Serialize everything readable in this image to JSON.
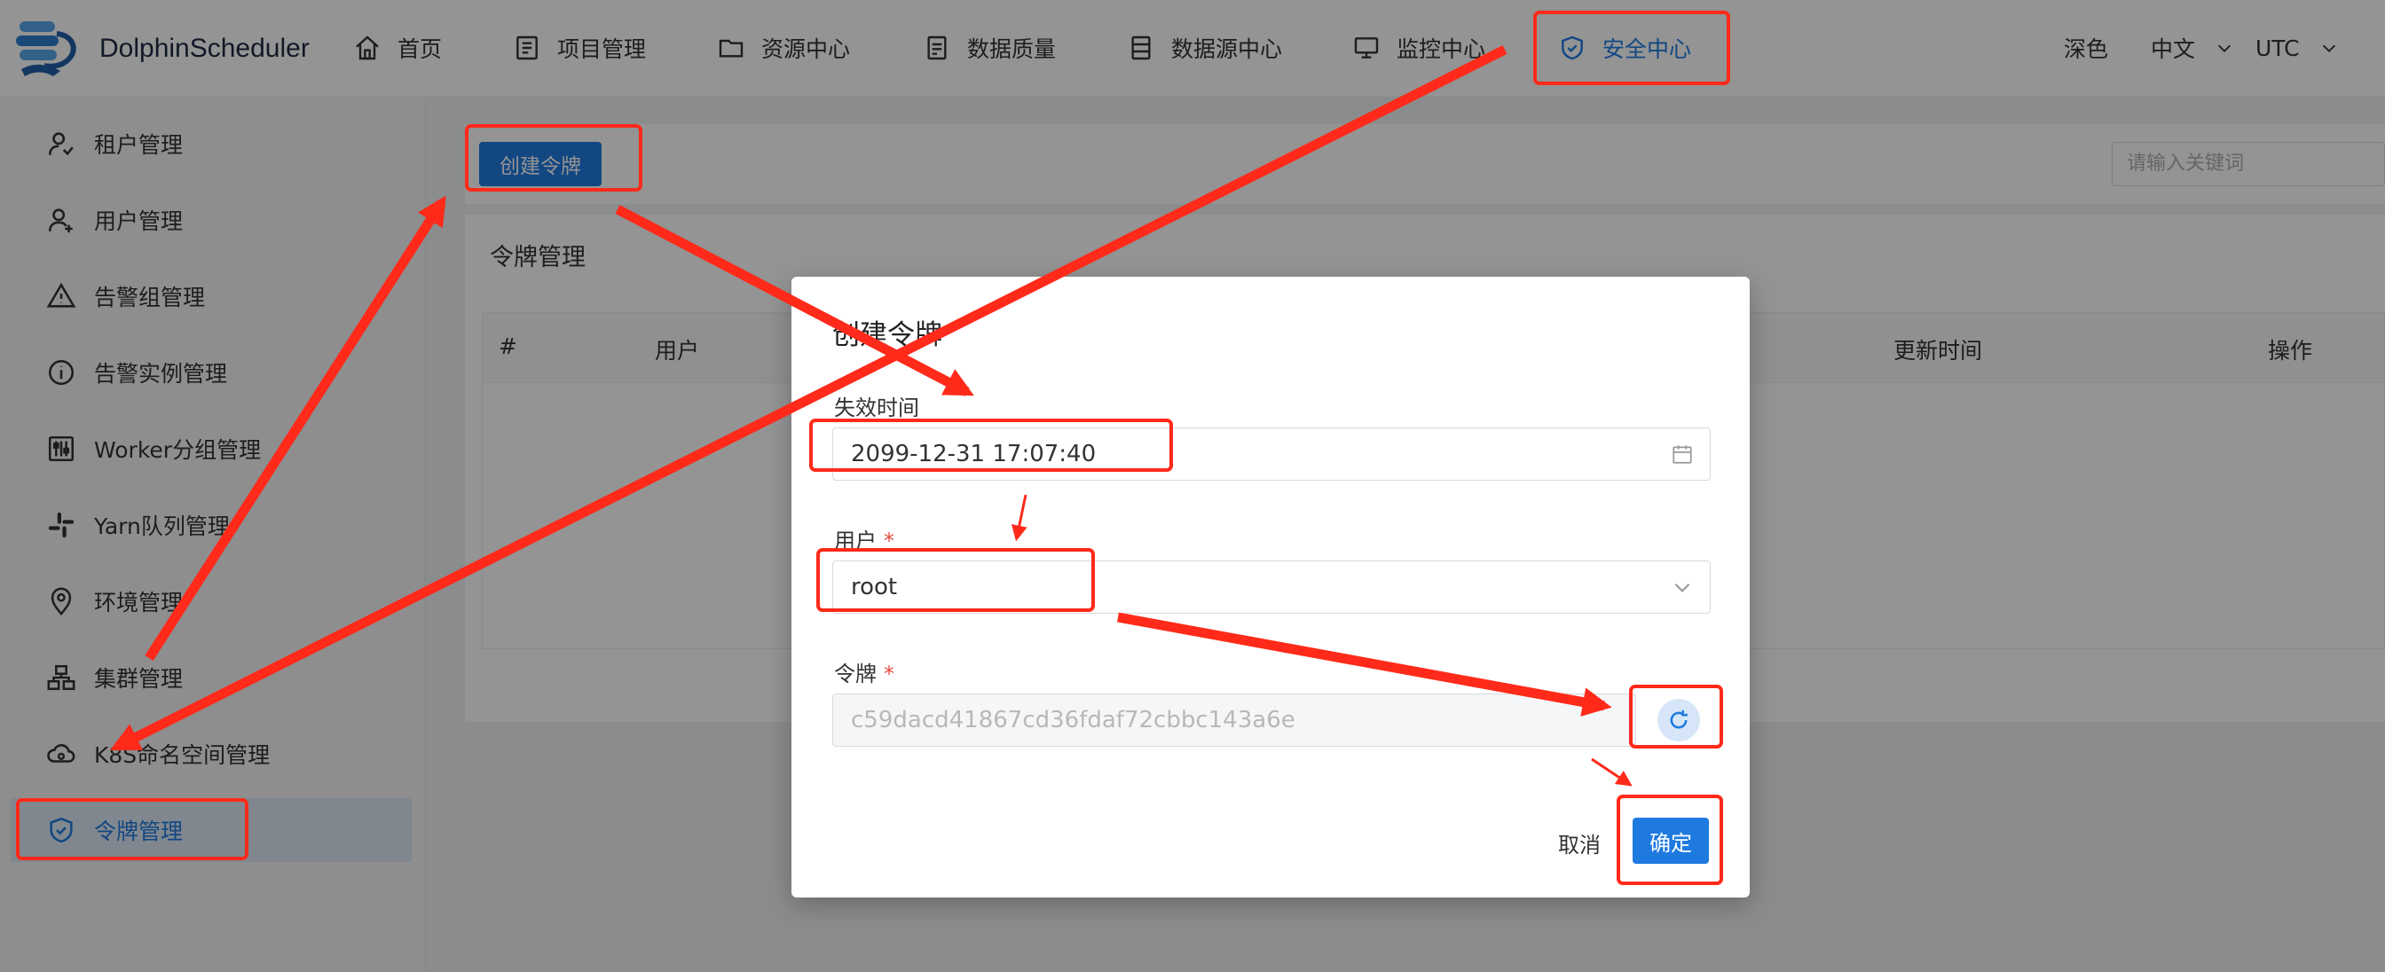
{
  "app": {
    "name": "DolphinScheduler"
  },
  "nav": {
    "items": [
      {
        "label": "首页"
      },
      {
        "label": "项目管理"
      },
      {
        "label": "资源中心"
      },
      {
        "label": "数据质量"
      },
      {
        "label": "数据源中心"
      },
      {
        "label": "监控中心"
      },
      {
        "label": "安全中心"
      }
    ],
    "active_index": 6,
    "theme": "深色",
    "language": "中文",
    "timezone": "UTC"
  },
  "sidebar": {
    "items": [
      {
        "label": "租户管理"
      },
      {
        "label": "用户管理"
      },
      {
        "label": "告警组管理"
      },
      {
        "label": "告警实例管理"
      },
      {
        "label": "Worker分组管理"
      },
      {
        "label": "Yarn队列管理"
      },
      {
        "label": "环境管理"
      },
      {
        "label": "集群管理"
      },
      {
        "label": "K8S命名空间管理"
      },
      {
        "label": "令牌管理"
      }
    ],
    "active_index": 9
  },
  "toolbar": {
    "create_label": "创建令牌",
    "search_placeholder": "请输入关键词"
  },
  "panel": {
    "title": "令牌管理",
    "columns": [
      "#",
      "用户",
      "更新时间",
      "操作"
    ]
  },
  "modal": {
    "title": "创建令牌",
    "expire_label": "失效时间",
    "expire_value": "2099-12-31 17:07:40",
    "user_label": "用户",
    "user_value": "root",
    "token_label": "令牌",
    "token_value": "c59dacd41867cd36fdaf72cbbc143a6e",
    "cancel_label": "取消",
    "confirm_label": "确定"
  },
  "colors": {
    "primary": "#1f7ae0",
    "annotation_red": "#ff2a1a",
    "overlay": "rgba(0,0,0,0.42)"
  }
}
